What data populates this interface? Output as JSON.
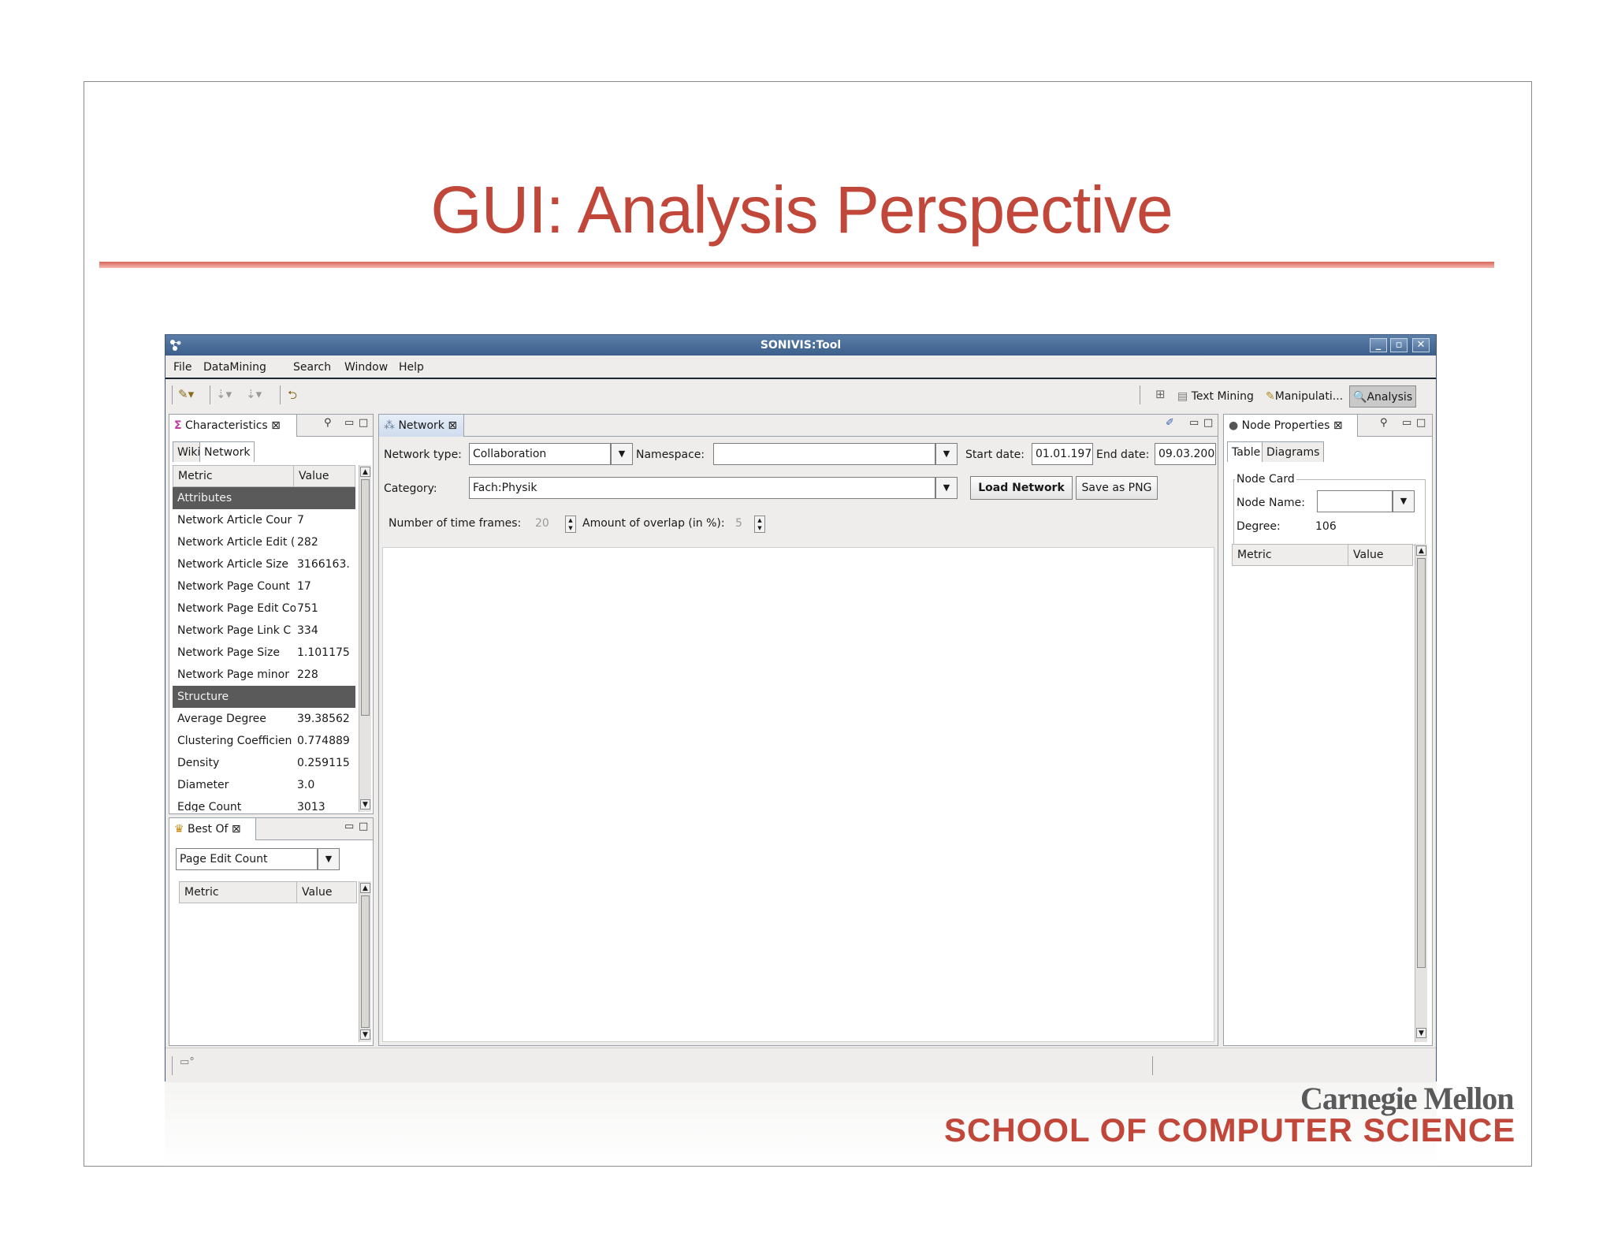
{
  "slide": {
    "title": "GUI: Analysis Perspective",
    "logo_top": "Carnegie Mellon",
    "logo_bottom": "SCHOOL OF COMPUTER SCIENCE"
  },
  "window": {
    "title": "SONIVIS:Tool",
    "minimize": "_",
    "maximize": "▫",
    "close": "✕"
  },
  "menu": [
    "File",
    "DataMining",
    "Search",
    "Window",
    "Help"
  ],
  "perspectives": {
    "text_mining": "Text Mining",
    "manipulation": "Manipulati...",
    "analysis": "Analysis"
  },
  "characteristics": {
    "tab": "Characteristics",
    "subtabs": [
      "Wiki",
      "Network"
    ],
    "col_metric": "Metric",
    "col_value": "Value",
    "rows": [
      {
        "group": "Attributes"
      },
      {
        "k": "Network Article Cour",
        "v": "7"
      },
      {
        "k": "Network Article Edit (",
        "v": "282"
      },
      {
        "k": "Network Article Size",
        "v": "3166163."
      },
      {
        "k": "Network Page Count",
        "v": "17"
      },
      {
        "k": "Network Page Edit Co",
        "v": "751"
      },
      {
        "k": "Network Page Link C",
        "v": "334"
      },
      {
        "k": "Network Page Size",
        "v": "1.101175"
      },
      {
        "k": "Network Page minor",
        "v": "228"
      },
      {
        "group": "Structure"
      },
      {
        "k": "Average Degree",
        "v": "39.38562"
      },
      {
        "k": "Clustering Coefficien",
        "v": "0.774889"
      },
      {
        "k": "Density",
        "v": "0.259115"
      },
      {
        "k": "Diameter",
        "v": "3.0"
      },
      {
        "k": "Edge Count",
        "v": "3013"
      }
    ]
  },
  "best_of": {
    "tab": "Best Of",
    "selected": "Page Edit Count",
    "col_metric": "Metric",
    "col_value": "Value"
  },
  "network": {
    "tab": "Network",
    "network_type_label": "Network type:",
    "network_type_value": "Collaboration",
    "namespace_label": "Namespace:",
    "namespace_value": "",
    "start_date_label": "Start date:",
    "start_date_value": "01.01.197",
    "end_date_label": "End date:",
    "end_date_value": "09.03.200",
    "category_label": "Category:",
    "category_value": "Fach:Physik",
    "load_button": "Load Network",
    "save_button": "Save as PNG",
    "time_frames_label": "Number of time frames:",
    "time_frames_value": "20",
    "overlap_label": "Amount of overlap (in %):",
    "overlap_value": "5"
  },
  "node_properties": {
    "tab": "Node Properties",
    "subtabs": [
      "Table",
      "Diagrams"
    ],
    "group_label": "Node Card",
    "node_name_label": "Node Name:",
    "node_name_value": "",
    "degree_label": "Degree:",
    "degree_value": "106",
    "col_metric": "Metric",
    "col_value": "Value"
  }
}
